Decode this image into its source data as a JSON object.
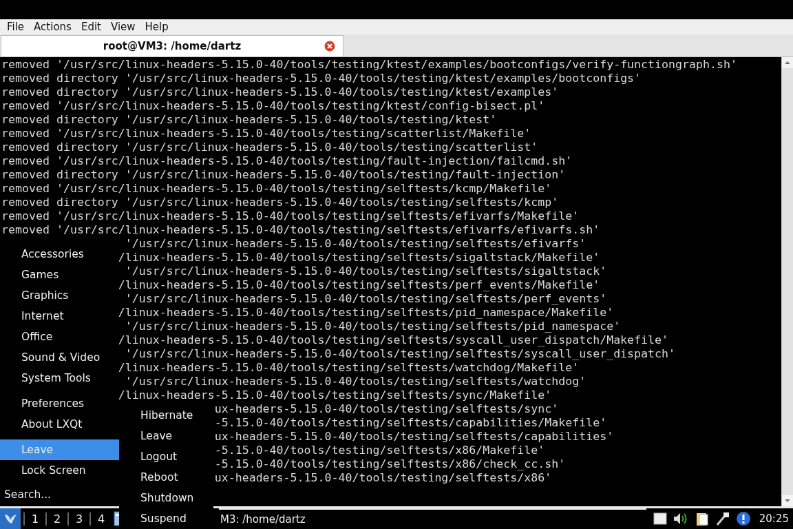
{
  "menubar": [
    "File",
    "Actions",
    "Edit",
    "View",
    "Help"
  ],
  "tab": {
    "title": "root@VM3: /home/dartz"
  },
  "terminal": {
    "lines": [
      {
        "kind": "full",
        "text": "removed '/usr/src/linux-headers-5.15.0-40/tools/testing/ktest/examples/bootconfigs/verify-functiongraph.sh'"
      },
      {
        "kind": "full",
        "text": "removed directory '/usr/src/linux-headers-5.15.0-40/tools/testing/ktest/examples/bootconfigs'"
      },
      {
        "kind": "full",
        "text": "removed directory '/usr/src/linux-headers-5.15.0-40/tools/testing/ktest/examples'"
      },
      {
        "kind": "full",
        "text": "removed '/usr/src/linux-headers-5.15.0-40/tools/testing/ktest/config-bisect.pl'"
      },
      {
        "kind": "full",
        "text": "removed directory '/usr/src/linux-headers-5.15.0-40/tools/testing/ktest'"
      },
      {
        "kind": "full",
        "text": "removed '/usr/src/linux-headers-5.15.0-40/tools/testing/scatterlist/Makefile'"
      },
      {
        "kind": "full",
        "text": "removed directory '/usr/src/linux-headers-5.15.0-40/tools/testing/scatterlist'"
      },
      {
        "kind": "full",
        "text": "removed '/usr/src/linux-headers-5.15.0-40/tools/testing/fault-injection/failcmd.sh'"
      },
      {
        "kind": "full",
        "text": "removed directory '/usr/src/linux-headers-5.15.0-40/tools/testing/fault-injection'"
      },
      {
        "kind": "full",
        "text": "removed '/usr/src/linux-headers-5.15.0-40/tools/testing/selftests/kcmp/Makefile'"
      },
      {
        "kind": "full",
        "text": "removed directory '/usr/src/linux-headers-5.15.0-40/tools/testing/selftests/kcmp'"
      },
      {
        "kind": "full",
        "text": "removed '/usr/src/linux-headers-5.15.0-40/tools/testing/selftests/efivarfs/Makefile'"
      },
      {
        "kind": "full",
        "text": "removed '/usr/src/linux-headers-5.15.0-40/tools/testing/selftests/efivarfs/efivarfs.sh'"
      },
      {
        "kind": "menu",
        "text": " '/usr/src/linux-headers-5.15.0-40/tools/testing/selftests/efivarfs'"
      },
      {
        "kind": "menu",
        "text": "/linux-headers-5.15.0-40/tools/testing/selftests/sigaltstack/Makefile'"
      },
      {
        "kind": "menu",
        "text": " '/usr/src/linux-headers-5.15.0-40/tools/testing/selftests/sigaltstack'"
      },
      {
        "kind": "menu",
        "text": "/linux-headers-5.15.0-40/tools/testing/selftests/perf_events/Makefile'"
      },
      {
        "kind": "menu",
        "text": " '/usr/src/linux-headers-5.15.0-40/tools/testing/selftests/perf_events'"
      },
      {
        "kind": "menu",
        "text": "/linux-headers-5.15.0-40/tools/testing/selftests/pid_namespace/Makefile'"
      },
      {
        "kind": "menu",
        "text": " '/usr/src/linux-headers-5.15.0-40/tools/testing/selftests/pid_namespace'"
      },
      {
        "kind": "menu",
        "text": "/linux-headers-5.15.0-40/tools/testing/selftests/syscall_user_dispatch/Makefile'"
      },
      {
        "kind": "menu",
        "text": " '/usr/src/linux-headers-5.15.0-40/tools/testing/selftests/syscall_user_dispatch'"
      },
      {
        "kind": "menu",
        "text": "/linux-headers-5.15.0-40/tools/testing/selftests/watchdog/Makefile'"
      },
      {
        "kind": "menu",
        "text": " '/usr/src/linux-headers-5.15.0-40/tools/testing/selftests/watchdog'"
      },
      {
        "kind": "menu",
        "text": "/linux-headers-5.15.0-40/tools/testing/selftests/sync/Makefile'"
      },
      {
        "kind": "submenu",
        "text": "ux-headers-5.15.0-40/tools/testing/selftests/sync'"
      },
      {
        "kind": "submenu",
        "text": "-5.15.0-40/tools/testing/selftests/capabilities/Makefile'"
      },
      {
        "kind": "submenu",
        "text": "ux-headers-5.15.0-40/tools/testing/selftests/capabilities'"
      },
      {
        "kind": "submenu",
        "text": "-5.15.0-40/tools/testing/selftests/x86/Makefile'"
      },
      {
        "kind": "submenu",
        "text": "-5.15.0-40/tools/testing/selftests/x86/check_cc.sh'"
      },
      {
        "kind": "submenu",
        "text": "ux-headers-5.15.0-40/tools/testing/selftests/x86'"
      }
    ]
  },
  "start_menu": {
    "sections": [
      [
        {
          "label": "Accessories",
          "selected": false
        },
        {
          "label": "Games",
          "selected": false
        },
        {
          "label": "Graphics",
          "selected": false
        },
        {
          "label": "Internet",
          "selected": false
        },
        {
          "label": "Office",
          "selected": false
        },
        {
          "label": "Sound & Video",
          "selected": false
        },
        {
          "label": "System Tools",
          "selected": false
        }
      ],
      [
        {
          "label": "Preferences",
          "selected": false
        },
        {
          "label": "About LXQt",
          "selected": false
        }
      ],
      [
        {
          "label": "Leave",
          "selected": true
        },
        {
          "label": "Lock Screen",
          "selected": false
        }
      ]
    ],
    "search": {
      "placeholder": "Search..."
    }
  },
  "leave_menu": [
    {
      "label": "Hibernate",
      "selected": false
    },
    {
      "label": "Leave",
      "selected": false
    },
    {
      "label": "Logout",
      "selected": false
    },
    {
      "label": "Reboot",
      "selected": false
    },
    {
      "label": "Shutdown",
      "selected": false
    },
    {
      "label": "Suspend",
      "selected": false
    }
  ],
  "taskbar": {
    "desktops": [
      {
        "label": "1",
        "selected": false
      },
      {
        "label": "2",
        "selected": false
      },
      {
        "label": "3",
        "selected": false
      },
      {
        "label": "4",
        "selected": false
      }
    ],
    "task": "M3: /home/dartz",
    "clock": "20:25"
  }
}
